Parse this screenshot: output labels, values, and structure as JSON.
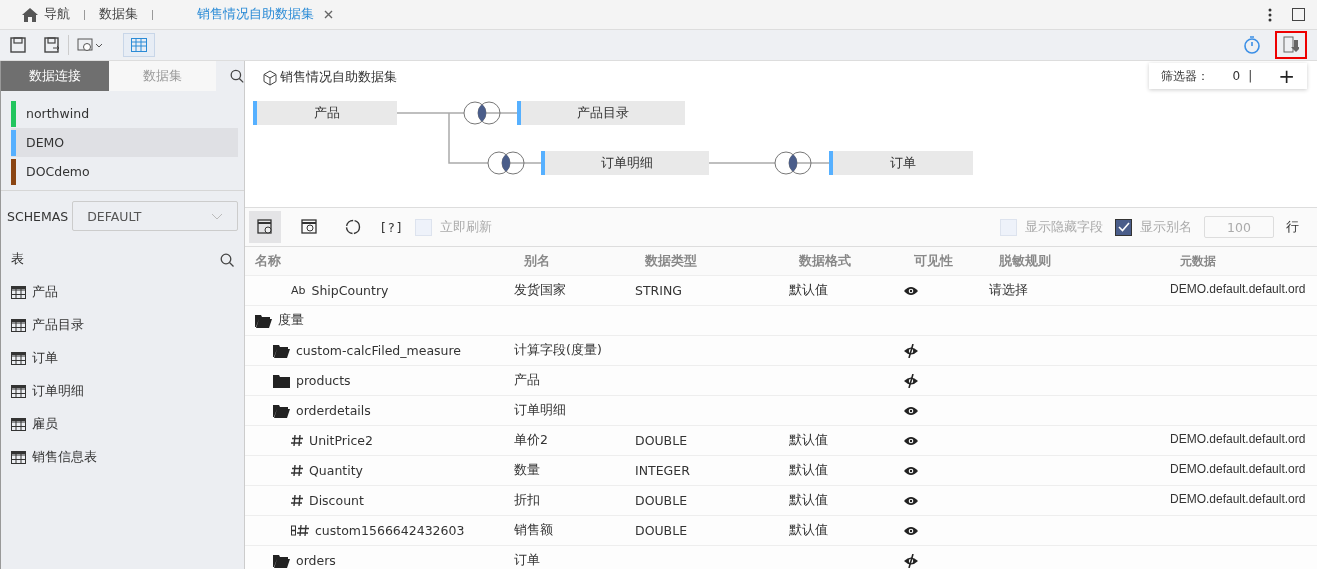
{
  "tabs": [
    {
      "label": "导航",
      "selected": false,
      "home": true
    },
    {
      "label": "数据集",
      "selected": false
    },
    {
      "label": "销售情况自助数据集",
      "selected": true,
      "closable": true
    }
  ],
  "toolbar": {
    "table_view_selected": true
  },
  "sidebar": {
    "tabs": [
      {
        "label": "数据连接",
        "selected": true
      },
      {
        "label": "数据集",
        "selected": false
      }
    ],
    "connections": [
      {
        "name": "northwind",
        "color": "#22c55e",
        "selected": false
      },
      {
        "name": "DEMO",
        "color": "#56b0ff",
        "selected": true
      },
      {
        "name": "DOCdemo",
        "color": "#8b4513",
        "selected": false
      }
    ],
    "schemas_label": "SCHEMAS",
    "schema_value": "DEFAULT",
    "tables_title": "表",
    "tables": [
      "产品",
      "产品目录",
      "订单",
      "订单明细",
      "雇员",
      "销售信息表"
    ]
  },
  "dataset": {
    "title": "销售情况自助数据集",
    "filter_label": "筛选器：",
    "filter_count": "0",
    "filter_separator": "|",
    "filter_add": "+",
    "nodes": [
      {
        "label": "产品"
      },
      {
        "label": "产品目录"
      },
      {
        "label": "订单明细"
      },
      {
        "label": "订单"
      }
    ]
  },
  "grid_toolbar": {
    "help": "[?]",
    "refresh_label": "立即刷新",
    "refresh_checked": false,
    "show_hidden_label": "显示隐藏字段",
    "show_hidden_checked": false,
    "show_alias_label": "显示别名",
    "show_alias_checked": true,
    "rows_value": "100",
    "rows_unit": "行"
  },
  "table": {
    "columns": [
      "名称",
      "别名",
      "数据类型",
      "数据格式",
      "可见性",
      "脱敏规则",
      "元数据"
    ],
    "rows": [
      {
        "kind": "text",
        "type_icon": "Ab",
        "name": "ShipCountry",
        "alias": "发货国家",
        "type": "STRING",
        "format": "默认值",
        "visible": true,
        "mask": "请选择",
        "meta": "DEMO.default.default.ord"
      },
      {
        "kind": "folder",
        "name": "度量",
        "children": [
          {
            "kind": "folder",
            "name": "custom-calcFiled_measure",
            "alias": "计算字段(度量)",
            "visible": false
          },
          {
            "kind": "folder",
            "name": "products",
            "alias": "产品",
            "visible": false,
            "expanded": false
          },
          {
            "kind": "folder",
            "name": "orderdetails",
            "alias": "订单明细",
            "visible": true,
            "children": [
              {
                "kind": "number",
                "name": "UnitPrice2",
                "alias": "单价2",
                "type": "DOUBLE",
                "format": "默认值",
                "visible": true,
                "meta": "DEMO.default.default.ord"
              },
              {
                "kind": "number",
                "name": "Quantity",
                "alias": "数量",
                "type": "INTEGER",
                "format": "默认值",
                "visible": true,
                "meta": "DEMO.default.default.ord"
              },
              {
                "kind": "number",
                "name": "Discount",
                "alias": "折扣",
                "type": "DOUBLE",
                "format": "默认值",
                "visible": true,
                "meta": "DEMO.default.default.ord"
              },
              {
                "kind": "calc",
                "name": "custom1566642432603",
                "alias": "销售额",
                "type": "DOUBLE",
                "format": "默认值",
                "visible": true
              }
            ]
          },
          {
            "kind": "folder",
            "name": "orders",
            "alias": "订单",
            "visible": false
          }
        ]
      }
    ]
  }
}
